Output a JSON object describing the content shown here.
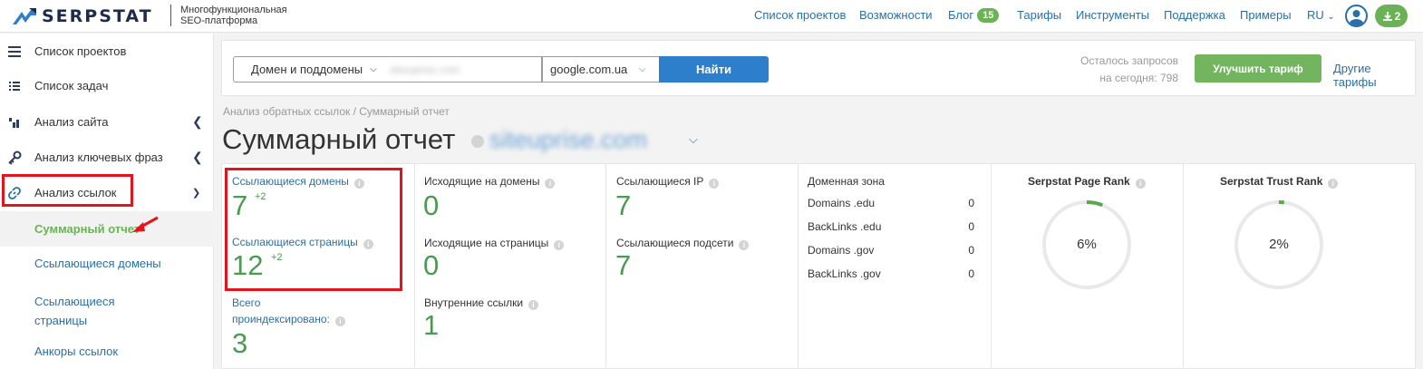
{
  "header": {
    "logo": "SERPSTAT",
    "subtitle_line1": "Многофункциональная",
    "subtitle_line2": "SEO-платформа",
    "nav": [
      {
        "label": "Список проектов"
      },
      {
        "label": "Возможности"
      },
      {
        "label": "Блог",
        "badge": "15"
      },
      {
        "label": "Тарифы"
      },
      {
        "label": "Инструменты"
      },
      {
        "label": "Поддержка"
      },
      {
        "label": "Примеры"
      }
    ],
    "lang": "RU",
    "downloads_count": "2"
  },
  "sidebar": {
    "items": [
      {
        "label": "Список проектов",
        "icon": "menu-icon"
      },
      {
        "label": "Список задач",
        "icon": "task-list-icon"
      },
      {
        "label": "Анализ сайта",
        "icon": "chart-icon"
      },
      {
        "label": "Анализ ключевых фраз",
        "icon": "key-icon"
      },
      {
        "label": "Анализ ссылок",
        "icon": "link-icon"
      }
    ],
    "sub_items": [
      {
        "label": "Суммарный отчет",
        "active": true
      },
      {
        "label": "Ссылающиеся домены"
      },
      {
        "label": "Ссылающиеся страницы"
      },
      {
        "label": "Анкоры ссылок"
      }
    ]
  },
  "search": {
    "scope": "Домен и поддомены",
    "domain_value": "siteuprise.com",
    "engine": "google.com.ua",
    "find_label": "Найти",
    "requests_line1": "Осталось запросов",
    "requests_line2": "на сегодня: 798",
    "upgrade_label": "Улучшить тариф",
    "other_plans_label": "Другие тарифы"
  },
  "page": {
    "breadcrumb": "Анализ обратных ссылок / Суммарный отчет",
    "title": "Суммарный отчет",
    "domain": "siteuprise.com"
  },
  "stats": {
    "ref_domains": {
      "label": "Ссылающиеся домены",
      "value": "7",
      "delta": "+2"
    },
    "ref_pages": {
      "label": "Ссылающиеся страницы",
      "value": "12",
      "delta": "+2"
    },
    "indexed": {
      "label_line1": "Всего",
      "label_line2": "проиндексировано:",
      "value": "3"
    },
    "out_domains": {
      "label": "Исходящие на домены",
      "value": "0"
    },
    "out_pages": {
      "label": "Исходящие на страницы",
      "value": "0"
    },
    "internal_links": {
      "label": "Внутренние ссылки",
      "value": "1"
    },
    "ref_ips": {
      "label": "Ссылающиеся IP",
      "value": "7"
    },
    "ref_subnets": {
      "label": "Ссылающиеся подсети",
      "value": "7"
    },
    "domain_zone": {
      "label": "Доменная зона",
      "rows": [
        {
          "name": "Domains .edu",
          "value": "0"
        },
        {
          "name": "BackLinks .edu",
          "value": "0"
        },
        {
          "name": "Domains .gov",
          "value": "0"
        },
        {
          "name": "BackLinks .gov",
          "value": "0"
        }
      ]
    },
    "page_rank": {
      "label": "Serpstat Page Rank",
      "value": "6%",
      "fraction": 0.06
    },
    "trust_rank": {
      "label": "Serpstat Trust Rank",
      "value": "2%",
      "fraction": 0.02
    }
  },
  "colors": {
    "accent_blue": "#2a6fa8",
    "accent_green": "#6bb257",
    "highlight_red": "#e3141b"
  }
}
